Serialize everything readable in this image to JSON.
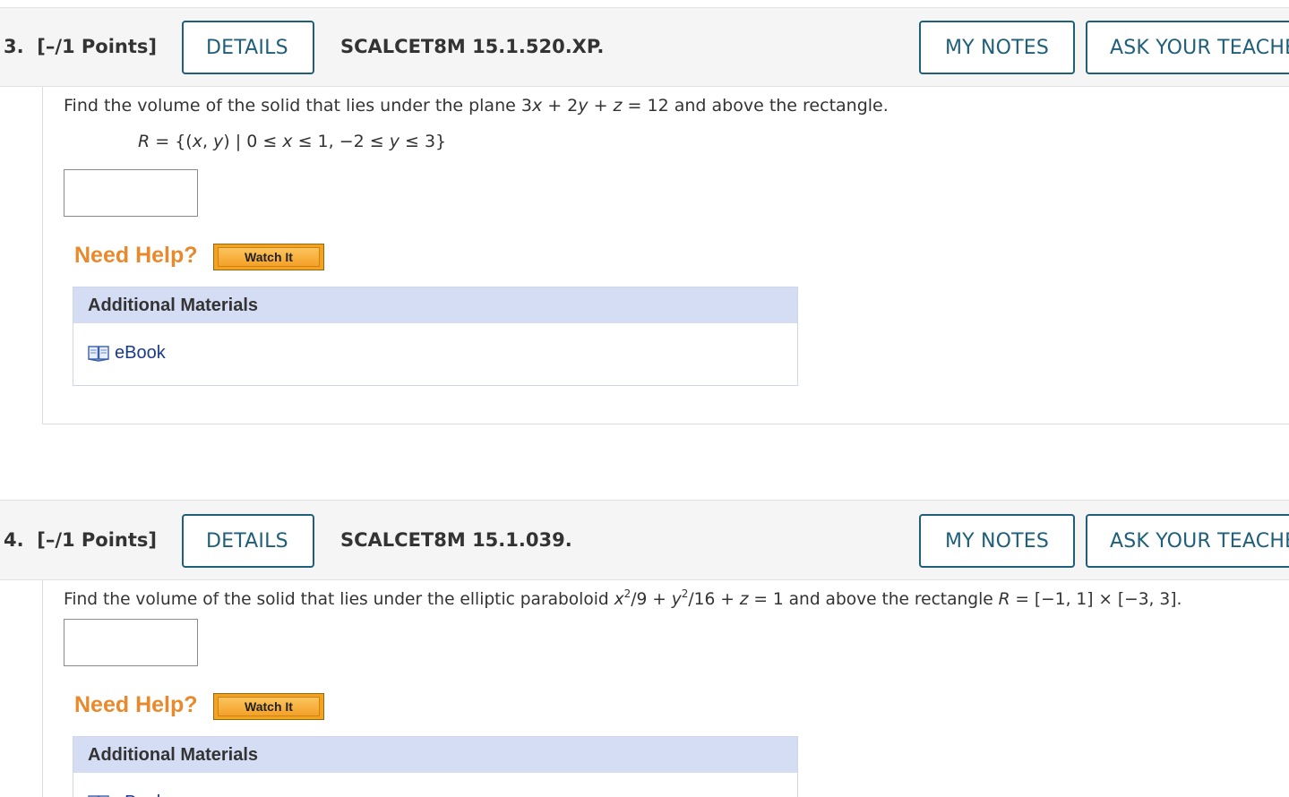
{
  "questions": [
    {
      "number_label": "3.",
      "points_label": "[–/1 Points]",
      "details_label": "DETAILS",
      "code": "SCALCET8M 15.1.520.XP.",
      "my_notes_label": "MY NOTES",
      "ask_teacher_label": "ASK YOUR TEACHER",
      "text_parts": {
        "intro": "Find the volume of the solid that lies under the plane 3",
        "x": "x",
        "plus1": " + 2",
        "y": "y",
        "plus2": " + ",
        "z": "z",
        "rest": " = 12 and above the rectangle."
      },
      "region_parts": {
        "R": "R",
        "eq": " = {(",
        "x1": "x",
        "comma": ", ",
        "y1": "y",
        "mid": ") | 0 ≤ ",
        "x2": "x",
        "mid2": " ≤ 1, −2 ≤ ",
        "y2": "y",
        "end": " ≤ 3}"
      },
      "answer_value": "",
      "need_help_label": "Need Help?",
      "watch_label": "Watch It",
      "materials_heading": "Additional Materials",
      "materials_items": [
        {
          "label": "eBook",
          "icon": "book-icon"
        }
      ]
    },
    {
      "number_label": "4.",
      "points_label": "[–/1 Points]",
      "details_label": "DETAILS",
      "code": "SCALCET8M 15.1.039.",
      "my_notes_label": "MY NOTES",
      "ask_teacher_label": "ASK YOUR TEACHER",
      "text_parts": {
        "intro": "Find the volume of the solid that lies under the elliptic paraboloid ",
        "x": "x",
        "exp1": "2",
        "div1": "/9 + ",
        "y": "y",
        "exp2": "2",
        "div2": "/16 + ",
        "z": "z",
        "eq": " = 1 ",
        "mid": " and above the rectangle ",
        "R": "R",
        "end": " = [−1, 1] × [−3, 3]."
      },
      "answer_value": "",
      "need_help_label": "Need Help?",
      "watch_label": "Watch It",
      "materials_heading": "Additional Materials",
      "materials_items": [
        {
          "label": "eBook",
          "icon": "book-icon"
        }
      ]
    }
  ],
  "colors": {
    "accent": "#1f5f7a",
    "need_help": "#e8892b",
    "watch_button": "#f7a21b",
    "materials_header": "#d5ddf5",
    "link": "#1a3a8c"
  }
}
